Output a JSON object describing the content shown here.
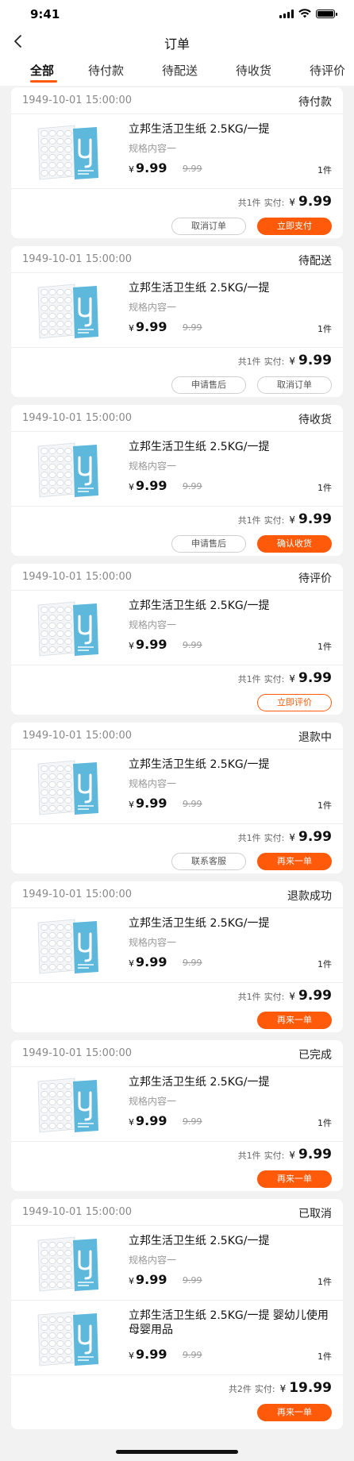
{
  "status_bar": {
    "time": "9:41"
  },
  "nav": {
    "back_icon": "chevron-left-icon",
    "title": "订单"
  },
  "tabs": [
    "全部",
    "待付款",
    "待配送",
    "待收货",
    "待评价"
  ],
  "active_tab": 0,
  "product": {
    "name": "立邦生活卫生纸 2.5KG/一提",
    "spec": "规格内容一",
    "currency": "¥",
    "price": "9.99",
    "original_price": "9.99",
    "qty": "1件"
  },
  "product2": {
    "name": "立邦生活卫生纸 2.5KG/一提 婴幼儿使用 母婴用品"
  },
  "summary": {
    "count_1": "共1件",
    "count_2": "共2件",
    "paid_label": "实付:",
    "currency": "¥",
    "amount_1": "9.99",
    "amount_2": "19.99"
  },
  "orders": [
    {
      "time": "1949-10-01 15:00:00",
      "status": "待付款",
      "buttons": [
        "取消订单",
        "立即支付"
      ]
    },
    {
      "time": "1949-10-01 15:00:00",
      "status": "待配送",
      "buttons": [
        "申请售后",
        "取消订单"
      ]
    },
    {
      "time": "1949-10-01 15:00:00",
      "status": "待收货",
      "buttons": [
        "申请售后",
        "确认收货"
      ]
    },
    {
      "time": "1949-10-01 15:00:00",
      "status": "待评价",
      "buttons": [
        "立即评价"
      ]
    },
    {
      "time": "1949-10-01 15:00:00",
      "status": "退款中",
      "buttons": [
        "联系客服",
        "再来一单"
      ]
    },
    {
      "time": "1949-10-01 15:00:00",
      "status": "退款成功",
      "buttons": [
        "再来一单"
      ]
    },
    {
      "time": "1949-10-01 15:00:00",
      "status": "已完成",
      "buttons": [
        "再来一单"
      ]
    },
    {
      "time": "1949-10-01 15:00:00",
      "status": "已取消",
      "buttons": [
        "再来一单"
      ]
    }
  ],
  "colors": {
    "accent": "#ff5a0a",
    "background": "#f2f2f2",
    "card": "#ffffff",
    "product_blue": "#5db8dc"
  }
}
